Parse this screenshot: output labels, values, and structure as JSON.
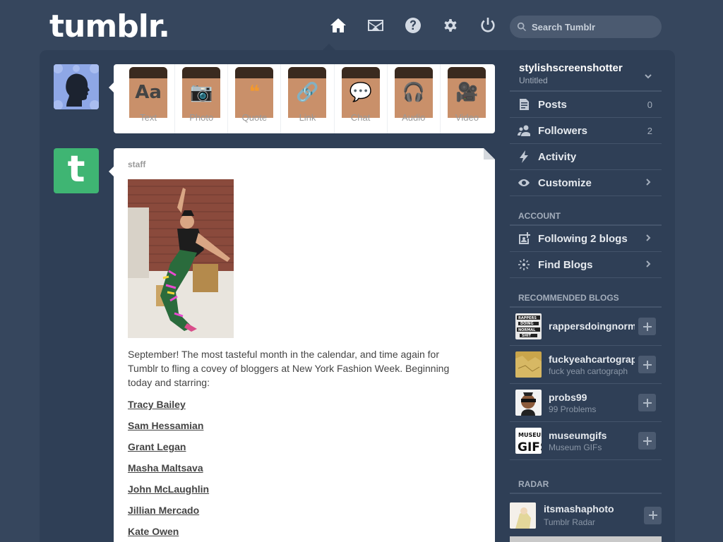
{
  "header": {
    "logo": "tumblr.",
    "nav": [
      "home-icon",
      "mail-icon",
      "help-icon",
      "gear-icon",
      "power-icon"
    ],
    "search_placeholder": "Search Tumblr"
  },
  "composer": {
    "buttons": [
      {
        "label": "Text",
        "glyph": "Aa",
        "color": "#444444"
      },
      {
        "label": "Photo",
        "glyph": "📷",
        "color": "#d95e40"
      },
      {
        "label": "Quote",
        "glyph": "❝",
        "color": "#f2992e"
      },
      {
        "label": "Link",
        "glyph": "🔗",
        "color": "#56bc8a"
      },
      {
        "label": "Chat",
        "glyph": "💬",
        "color": "#529ecc"
      },
      {
        "label": "Audio",
        "glyph": "🎧",
        "color": "#a77dc2"
      },
      {
        "label": "Video",
        "glyph": "🎥",
        "color": "#748089"
      }
    ]
  },
  "post": {
    "author": "staff",
    "text": "September! The most tasteful month in the calendar, and time again for Tumblr to fling a covey of bloggers at New York Fashion Week. Beginning today and starring:",
    "links": [
      "Tracy Bailey",
      "Sam Hessamian",
      "Grant Legan",
      "Masha Maltsava",
      "John McLaughlin",
      "Jillian Mercado",
      "Kate Owen"
    ]
  },
  "sidebar": {
    "blog_name": "stylishscreenshotter",
    "blog_sub": "Untitled",
    "menu": [
      {
        "label": "Posts",
        "count": "0",
        "icon": "posts-icon"
      },
      {
        "label": "Followers",
        "count": "2",
        "icon": "followers-icon"
      },
      {
        "label": "Activity",
        "icon": "activity-icon"
      },
      {
        "label": "Customize",
        "icon": "eye-icon",
        "arrow": true
      }
    ],
    "account_title": "ACCOUNT",
    "account": [
      {
        "label": "Following 2 blogs",
        "icon": "following-icon"
      },
      {
        "label": "Find Blogs",
        "icon": "find-icon"
      }
    ],
    "recommended_title": "RECOMMENDED BLOGS",
    "recommended": [
      {
        "name": "rappersdoingnorm",
        "desc": "",
        "color": "#e8e8e8"
      },
      {
        "name": "fuckyeahcartograp",
        "desc": "fuck yeah cartograph",
        "color": "#c9a54b"
      },
      {
        "name": "probs99",
        "desc": "99 Problems",
        "color": "#f2f2f2"
      },
      {
        "name": "museumgifs",
        "desc": "Museum GIFs",
        "color": "#ffffff"
      }
    ],
    "radar_title": "RADAR",
    "radar": {
      "name": "itsmashaphoto",
      "desc": "Tumblr Radar"
    }
  }
}
